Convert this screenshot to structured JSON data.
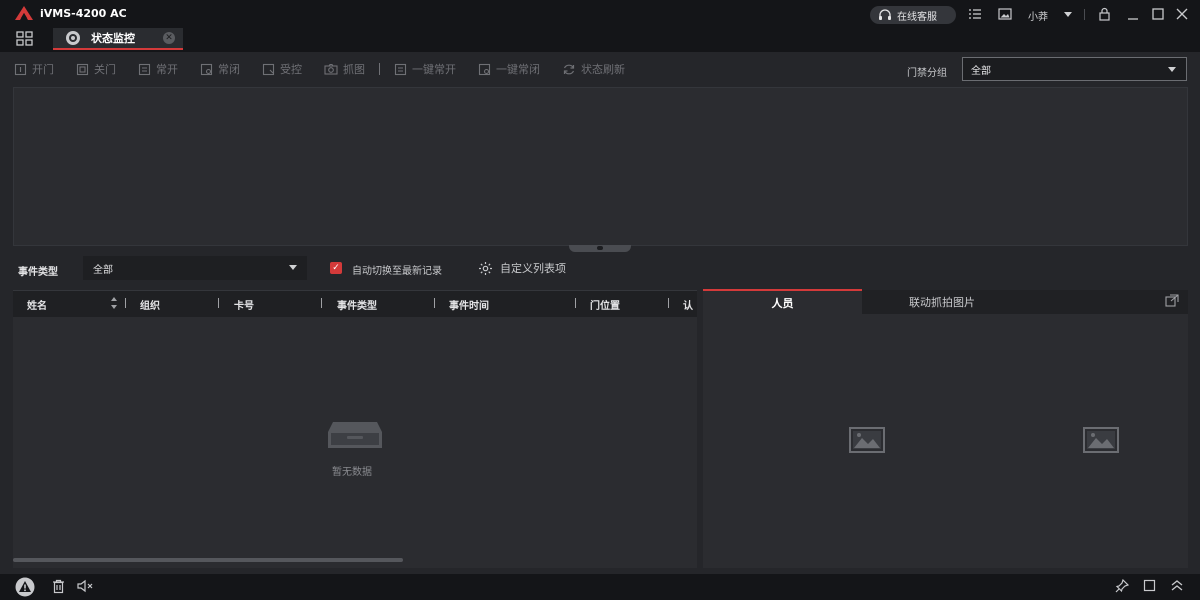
{
  "app": {
    "title": "iVMS-4200 AC",
    "brand_color": "#d43a3a"
  },
  "titlebar": {
    "support_label": "在线客服",
    "user_name": "小莽"
  },
  "tabs": [
    {
      "label": "状态监控",
      "active": true
    }
  ],
  "toolbar": {
    "open_door": "开门",
    "close_door": "关门",
    "remain_open": "常开",
    "remain_closed": "常闭",
    "controlled": "受控",
    "capture": "抓图",
    "all_open": "一键常开",
    "all_closed": "一键常闭",
    "refresh": "状态刷新",
    "group_label": "门禁分组",
    "group_value": "全部"
  },
  "filter": {
    "event_type_label": "事件类型",
    "event_type_value": "全部",
    "auto_switch_label": "自动切换至最新记录",
    "auto_switch_checked": true,
    "custom_columns_label": "自定义列表项"
  },
  "event_table": {
    "columns": [
      "姓名",
      "组织",
      "卡号",
      "事件类型",
      "事件时间",
      "门位置",
      "认"
    ],
    "rows": [],
    "empty_text": "暂无数据"
  },
  "detail_panel": {
    "tabs": [
      "人员",
      "联动抓拍图片"
    ],
    "active_tab": "人员"
  }
}
